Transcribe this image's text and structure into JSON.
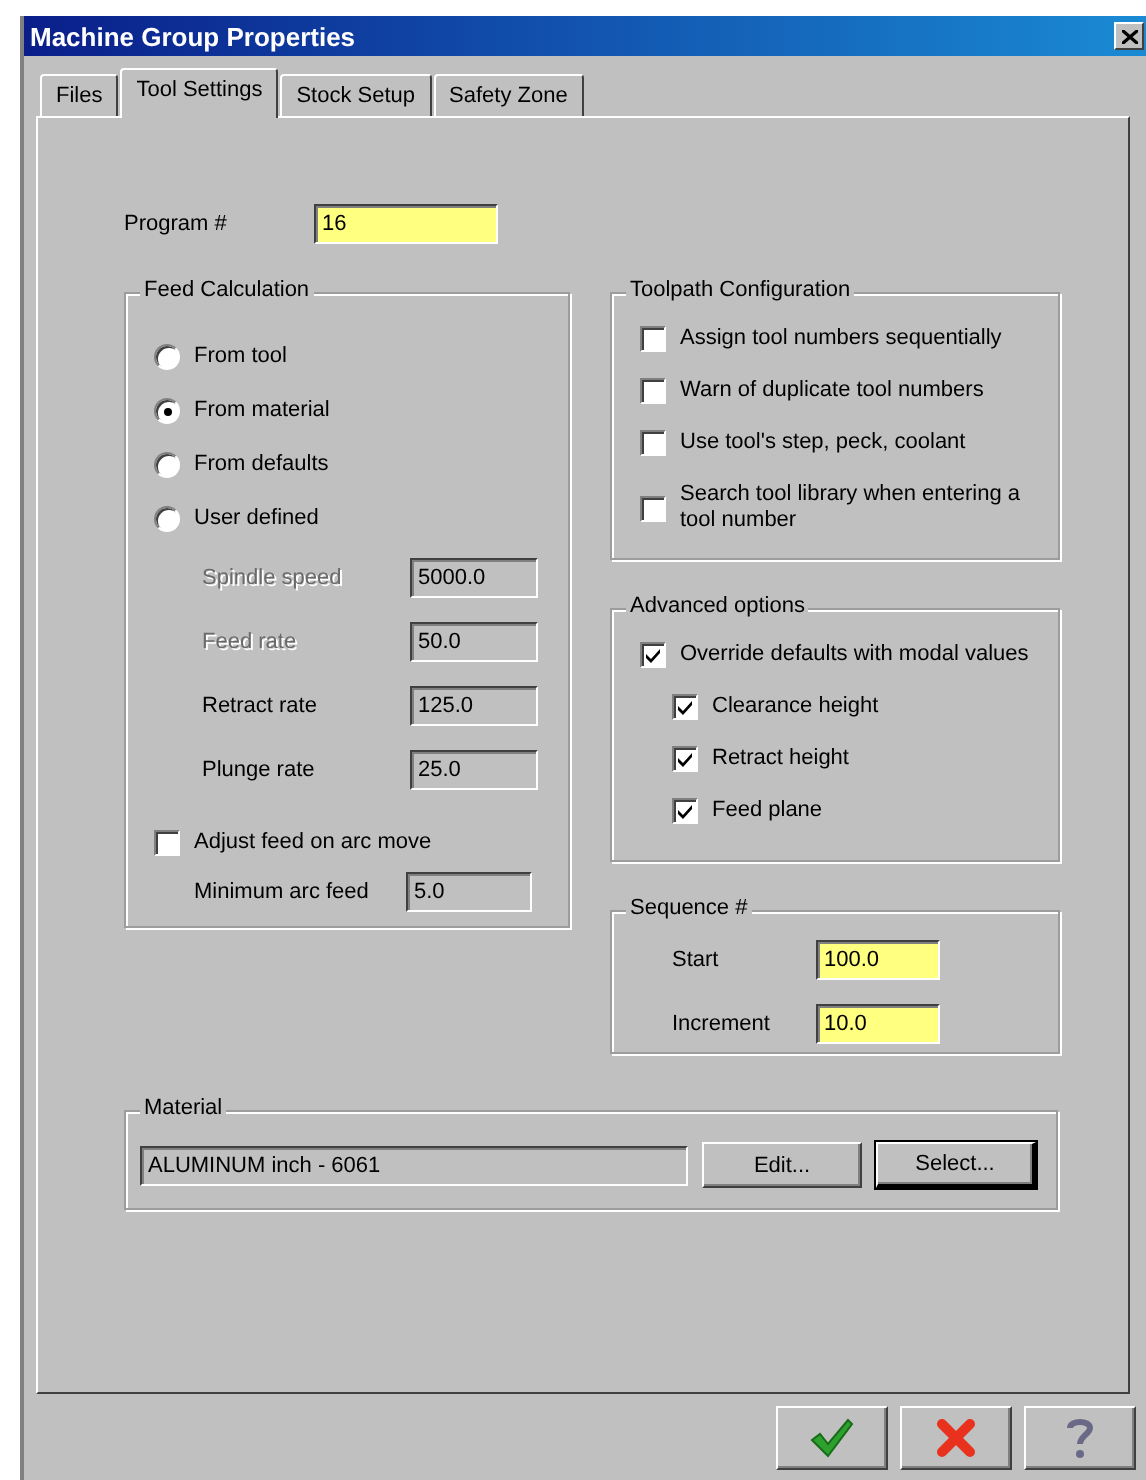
{
  "window": {
    "title": "Machine Group Properties"
  },
  "tabs": [
    {
      "label": "Files",
      "selected": false
    },
    {
      "label": "Tool Settings",
      "selected": true
    },
    {
      "label": "Stock Setup",
      "selected": false
    },
    {
      "label": "Safety Zone",
      "selected": false
    }
  ],
  "program": {
    "label": "Program #",
    "value": "16",
    "readonly": false
  },
  "feed_calculation": {
    "title": "Feed Calculation",
    "options": [
      {
        "label": "From tool",
        "selected": false
      },
      {
        "label": "From material",
        "selected": true
      },
      {
        "label": "From defaults",
        "selected": false
      },
      {
        "label": "User defined",
        "selected": false
      }
    ],
    "fields": [
      {
        "label": "Spindle speed",
        "value": "5000.0",
        "disabled": true,
        "readonly": true
      },
      {
        "label": "Feed rate",
        "value": "50.0",
        "disabled": true,
        "readonly": true
      },
      {
        "label": "Retract rate",
        "value": "125.0",
        "disabled": false,
        "readonly": true
      },
      {
        "label": "Plunge rate",
        "value": "25.0",
        "disabled": false,
        "readonly": true
      }
    ],
    "adjust_arc": {
      "label": "Adjust feed on arc move",
      "checked": false
    },
    "min_arc_feed": {
      "label": "Minimum arc feed",
      "value": "5.0",
      "readonly": true
    }
  },
  "toolpath_configuration": {
    "title": "Toolpath Configuration",
    "options": [
      {
        "label": "Assign tool numbers sequentially",
        "checked": false
      },
      {
        "label": "Warn of duplicate tool numbers",
        "checked": false
      },
      {
        "label": "Use tool's step, peck, coolant",
        "checked": false
      },
      {
        "label": "Search tool library when entering a tool number",
        "checked": false
      }
    ]
  },
  "advanced_options": {
    "title": "Advanced options",
    "options": [
      {
        "label": "Override defaults with modal values",
        "checked": true,
        "children": [
          {
            "label": "Clearance height",
            "checked": true
          },
          {
            "label": "Retract height",
            "checked": true
          },
          {
            "label": "Feed plane",
            "checked": true
          }
        ]
      }
    ]
  },
  "sequence": {
    "title": "Sequence #",
    "fields": [
      {
        "label": "Start",
        "value": "100.0",
        "readonly": false
      },
      {
        "label": "Increment",
        "value": "10.0",
        "readonly": false
      }
    ]
  },
  "material": {
    "title": "Material",
    "value": "ALUMINUM inch - 6061",
    "readonly": true,
    "buttons": [
      {
        "label": "Edit...",
        "default": false
      },
      {
        "label": "Select...",
        "default": true
      }
    ]
  },
  "dialog_buttons": [
    {
      "kind": "ok"
    },
    {
      "kind": "cancel"
    },
    {
      "kind": "help"
    }
  ]
}
